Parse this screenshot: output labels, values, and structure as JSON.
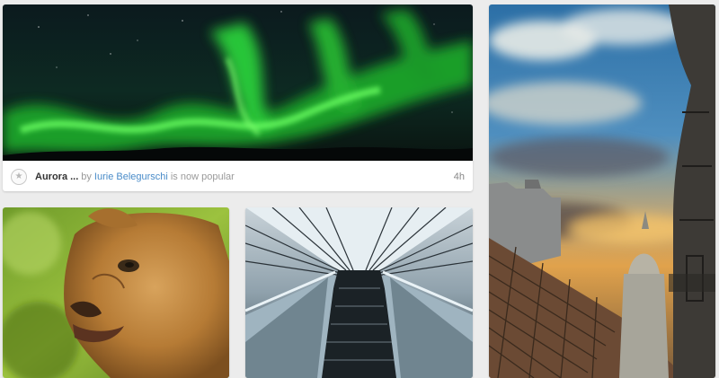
{
  "feed": {
    "cards": [
      {
        "title": "Aurora ...",
        "by": "by",
        "author": "Iurie Belegurschi",
        "status": "is now popular",
        "time": "4h",
        "icon": "star-icon"
      }
    ]
  },
  "colors": {
    "background": "#ececec",
    "card": "#ffffff",
    "link": "#4a8cc9",
    "muted_text": "#9a9a9a"
  }
}
